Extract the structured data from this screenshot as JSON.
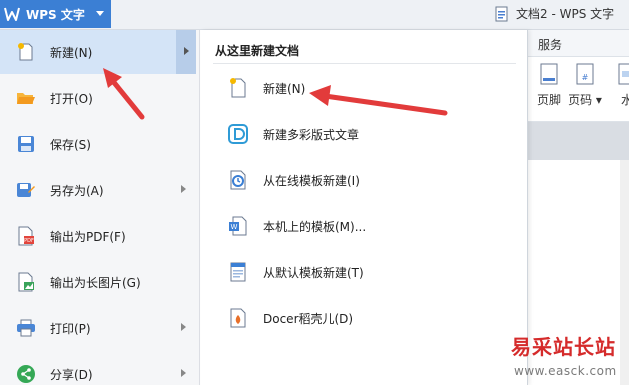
{
  "app": {
    "name": "WPS 文字",
    "document_title": "文档2 - WPS 文字",
    "brand_color": "#3b7fd4"
  },
  "ribbon": {
    "tab_label": "服务",
    "items": [
      {
        "label": "页脚",
        "icon": "footer-icon"
      },
      {
        "label": "页码",
        "icon": "page-number-icon"
      },
      {
        "label": "水",
        "icon": "watermark-icon"
      }
    ]
  },
  "file_menu": {
    "items": [
      {
        "label": "新建(N)",
        "icon": "new-document-icon",
        "has_submenu": true,
        "active": true
      },
      {
        "label": "打开(O)",
        "icon": "open-folder-icon",
        "has_submenu": false
      },
      {
        "label": "保存(S)",
        "icon": "save-icon",
        "has_submenu": false
      },
      {
        "label": "另存为(A)",
        "icon": "save-as-icon",
        "has_submenu": true
      },
      {
        "label": "输出为PDF(F)",
        "icon": "pdf-icon",
        "has_submenu": false
      },
      {
        "label": "输出为长图片(G)",
        "icon": "image-export-icon",
        "has_submenu": false
      },
      {
        "label": "打印(P)",
        "icon": "print-icon",
        "has_submenu": true
      },
      {
        "label": "分享(D)",
        "icon": "share-icon",
        "has_submenu": true
      }
    ]
  },
  "new_submenu": {
    "title": "从这里新建文档",
    "items": [
      {
        "label": "新建(N)",
        "icon": "blank-document-icon"
      },
      {
        "label": "新建多彩版式文章",
        "icon": "colorful-article-icon"
      },
      {
        "label": "从在线模板新建(I)",
        "icon": "online-template-icon"
      },
      {
        "label": "本机上的模板(M)...",
        "icon": "local-template-icon"
      },
      {
        "label": "从默认模板新建(T)",
        "icon": "default-template-icon"
      },
      {
        "label": "Docer稻壳儿(D)",
        "icon": "docer-icon"
      }
    ]
  },
  "watermark": {
    "title": "易采站长站",
    "url": "www.easck.com"
  },
  "colors": {
    "highlight": "#d4e4f7",
    "annotation_arrow": "#e23b3b"
  }
}
